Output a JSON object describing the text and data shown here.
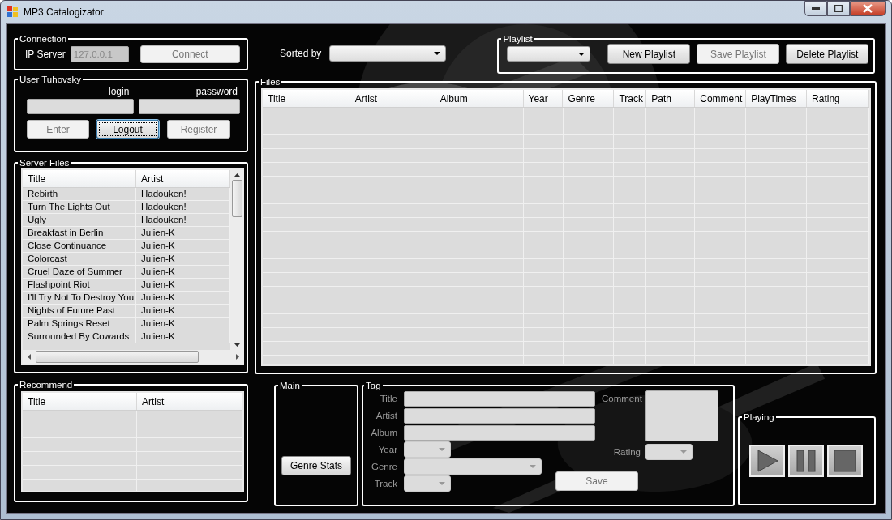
{
  "window": {
    "title": "MP3 Catalogizator"
  },
  "connection": {
    "title": "Connection",
    "ip_label": "IP Server",
    "ip_value": "127.0.0.1",
    "ip_disabled": true,
    "button": {
      "label": "Connect",
      "disabled": true
    }
  },
  "user": {
    "title": "User Tuhovsky",
    "login_label": "login",
    "password_label": "password",
    "buttons": [
      {
        "label": "Enter",
        "disabled": true,
        "focused": false
      },
      {
        "label": "Logout",
        "disabled": false,
        "focused": true
      },
      {
        "label": "Register",
        "disabled": true,
        "focused": false
      }
    ]
  },
  "sorted_by": {
    "label": "Sorted by"
  },
  "playlist": {
    "title": "Playlist",
    "buttons": [
      {
        "label": "New Playlist",
        "disabled": false
      },
      {
        "label": "Save Playlist",
        "disabled": true
      },
      {
        "label": "Delete Playlist",
        "disabled": false
      }
    ]
  },
  "server_files": {
    "title": "Server Files",
    "columns": [
      "Title",
      "Artist"
    ],
    "rows": [
      [
        "Rebirth",
        "Hadouken!"
      ],
      [
        "Turn The Lights Out",
        "Hadouken!"
      ],
      [
        "Ugly",
        "Hadouken!"
      ],
      [
        "Breakfast in Berlin",
        "Julien-K"
      ],
      [
        "Close Continuance",
        "Julien-K"
      ],
      [
        "Colorcast",
        "Julien-K"
      ],
      [
        "Cruel Daze of Summer",
        "Julien-K"
      ],
      [
        "Flashpoint Riot",
        "Julien-K"
      ],
      [
        "I'll Try Not To Destroy You",
        "Julien-K"
      ],
      [
        "Nights of Future Past",
        "Julien-K"
      ],
      [
        "Palm Springs Reset",
        "Julien-K"
      ],
      [
        "Surrounded By Cowards",
        "Julien-K"
      ]
    ]
  },
  "files": {
    "title": "Files",
    "columns": [
      "Title",
      "Artist",
      "Album",
      "Year",
      "Genre",
      "Track",
      "Path",
      "Comment",
      "PlayTimes",
      "Rating"
    ]
  },
  "recommend": {
    "title": "Recommend",
    "columns": [
      "Title",
      "Artist"
    ]
  },
  "main": {
    "title": "Main",
    "button": {
      "label": "Genre Stats",
      "disabled": false
    }
  },
  "tag": {
    "title": "Tag",
    "disabled": true,
    "fields": [
      {
        "label": "Title",
        "kind": "text"
      },
      {
        "label": "Artist",
        "kind": "text"
      },
      {
        "label": "Album",
        "kind": "text"
      },
      {
        "label": "Year",
        "kind": "small-combo"
      },
      {
        "label": "Genre",
        "kind": "combo"
      },
      {
        "label": "Track",
        "kind": "small-combo"
      }
    ],
    "comment_label": "Comment",
    "rating_label": "Rating",
    "save": {
      "label": "Save",
      "disabled": true
    }
  },
  "playing": {
    "title": "Playing",
    "buttons": [
      {
        "kind": "play"
      },
      {
        "kind": "pause"
      },
      {
        "kind": "stop"
      }
    ]
  }
}
